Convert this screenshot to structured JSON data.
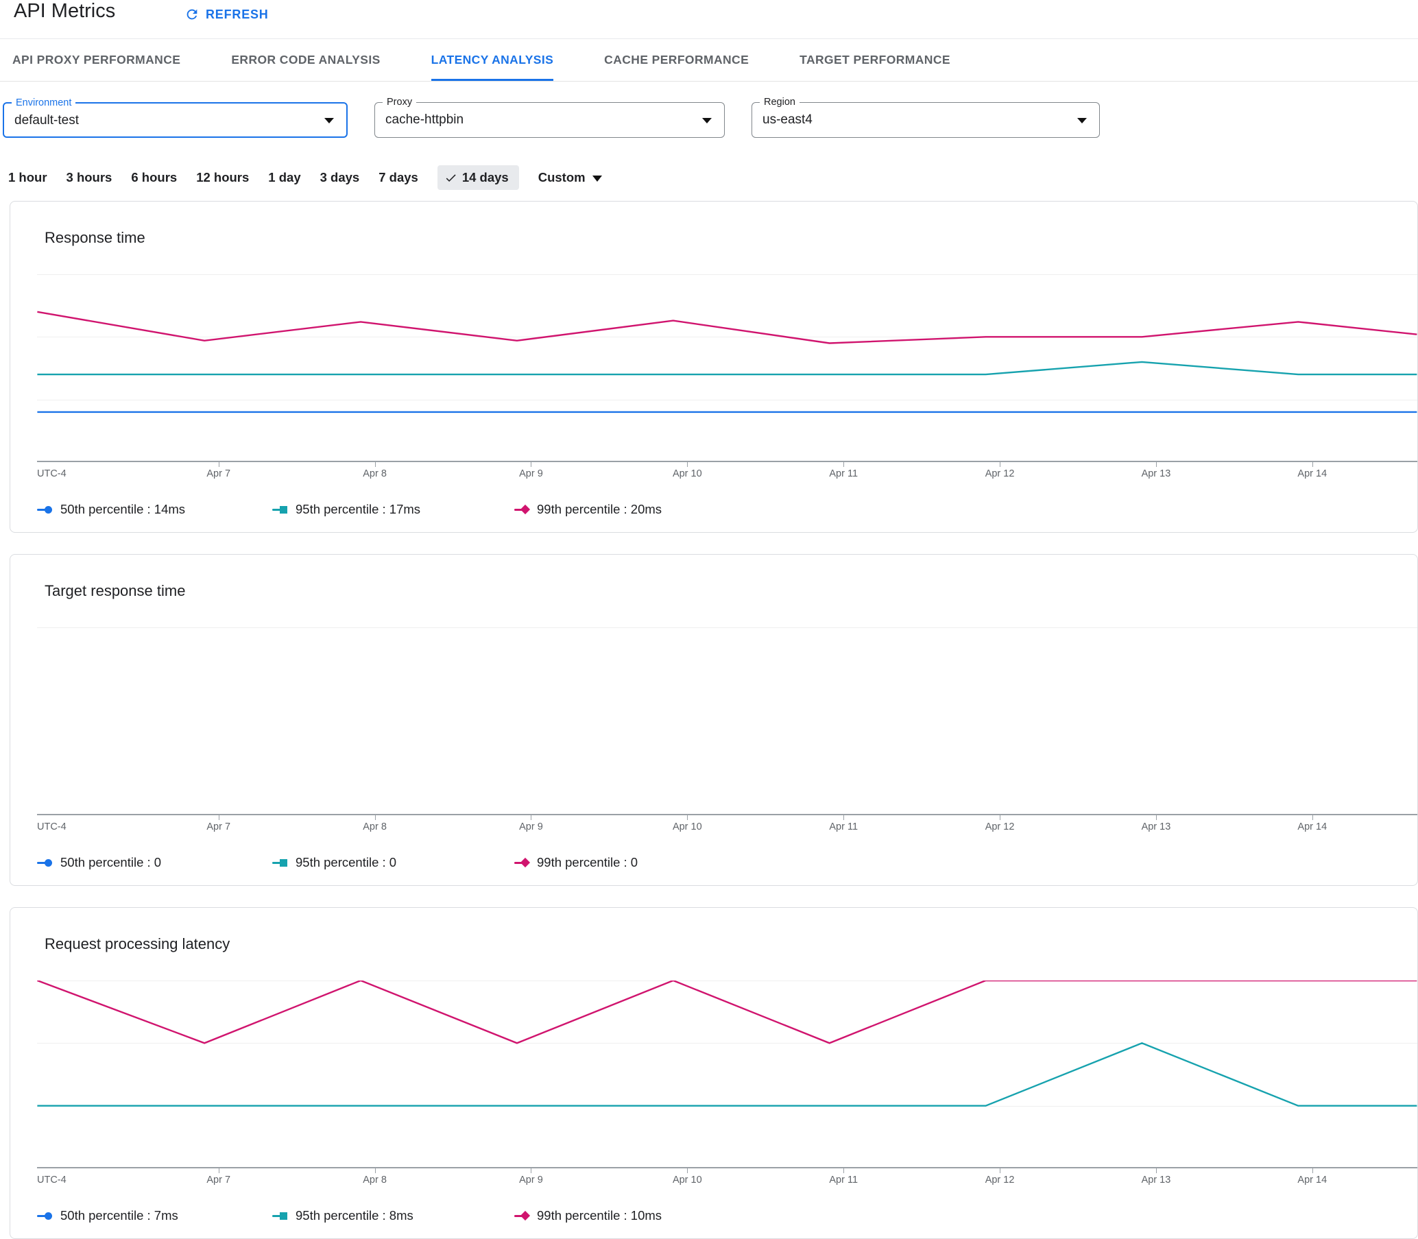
{
  "header": {
    "title": "API Metrics",
    "refresh_label": "REFRESH"
  },
  "tabs": [
    {
      "label": "API PROXY PERFORMANCE",
      "active": false
    },
    {
      "label": "ERROR CODE ANALYSIS",
      "active": false
    },
    {
      "label": "LATENCY ANALYSIS",
      "active": true
    },
    {
      "label": "CACHE PERFORMANCE",
      "active": false
    },
    {
      "label": "TARGET PERFORMANCE",
      "active": false
    }
  ],
  "filters": [
    {
      "label": "Environment",
      "value": "default-test",
      "focused": true
    },
    {
      "label": "Proxy",
      "value": "cache-httpbin",
      "focused": false
    },
    {
      "label": "Region",
      "value": "us-east4",
      "focused": false
    }
  ],
  "time_range": {
    "options": [
      "1 hour",
      "3 hours",
      "6 hours",
      "12 hours",
      "1 day",
      "3 days",
      "7 days",
      "14 days"
    ],
    "selected": "14 days",
    "custom_label": "Custom"
  },
  "colors": {
    "accent_blue": "#1a73e8",
    "series_blue": "#1a73e8",
    "series_teal": "#16a2ae",
    "series_pink": "#d0146e",
    "axis": "#9aa0a6",
    "gridline": "#efefef",
    "chip_bg": "#e8eaed"
  },
  "chart_data": [
    {
      "type": "line",
      "title": "Response time",
      "x_axis_label": "UTC-4",
      "x_ticks": [
        "Apr 7",
        "Apr 8",
        "Apr 9",
        "Apr 10",
        "Apr 11",
        "Apr 12",
        "Apr 13",
        "Apr 14"
      ],
      "x_tick_fracs": [
        0.1315,
        0.2447,
        0.3579,
        0.4711,
        0.5843,
        0.6975,
        0.8107,
        0.9239
      ],
      "x": [
        5.84,
        6.91,
        7.91,
        8.91,
        9.91,
        10.91,
        11.91,
        12.91,
        13.91,
        14.67
      ],
      "ylim": [
        10,
        25
      ],
      "gridline_values": [
        25,
        20,
        15
      ],
      "grid": true,
      "legend_position": "bottom",
      "series": [
        {
          "name": "50th percentile",
          "current_value": "14ms",
          "color_key": "series_blue",
          "marker": "circle",
          "values": [
            14,
            14,
            14,
            14,
            14,
            14,
            14,
            14,
            14,
            14
          ]
        },
        {
          "name": "95th percentile",
          "current_value": "17ms",
          "color_key": "series_teal",
          "marker": "square",
          "values": [
            17,
            17,
            17,
            17,
            17,
            17,
            17,
            18,
            17,
            17
          ]
        },
        {
          "name": "99th percentile",
          "current_value": "20ms",
          "color_key": "series_pink",
          "marker": "diamond",
          "values": [
            22,
            19.7,
            21.2,
            19.7,
            21.3,
            19.5,
            20,
            20,
            21.2,
            20.2
          ]
        }
      ]
    },
    {
      "type": "line",
      "title": "Target response time",
      "x_axis_label": "UTC-4",
      "x_ticks": [
        "Apr 7",
        "Apr 8",
        "Apr 9",
        "Apr 10",
        "Apr 11",
        "Apr 12",
        "Apr 13",
        "Apr 14"
      ],
      "x_tick_fracs": [
        0.1315,
        0.2447,
        0.3579,
        0.4711,
        0.5843,
        0.6975,
        0.8107,
        0.9239
      ],
      "x": [
        5.84,
        6.91,
        7.91,
        8.91,
        9.91,
        10.91,
        11.91,
        12.91,
        13.91,
        14.67
      ],
      "ylim": [
        0,
        1
      ],
      "gridline_values": [
        1
      ],
      "grid": true,
      "legend_position": "bottom",
      "series": [
        {
          "name": "50th percentile",
          "current_value": "0",
          "color_key": "series_blue",
          "marker": "circle",
          "values": [
            0,
            0,
            0,
            0,
            0,
            0,
            0,
            0,
            0,
            0
          ]
        },
        {
          "name": "95th percentile",
          "current_value": "0",
          "color_key": "series_teal",
          "marker": "square",
          "values": [
            0,
            0,
            0,
            0,
            0,
            0,
            0,
            0,
            0,
            0
          ]
        },
        {
          "name": "99th percentile",
          "current_value": "0",
          "color_key": "series_pink",
          "marker": "diamond",
          "values": [
            0,
            0,
            0,
            0,
            0,
            0,
            0,
            0,
            0,
            0
          ]
        }
      ]
    },
    {
      "type": "line",
      "title": "Request processing latency",
      "x_axis_label": "UTC-4",
      "x_ticks": [
        "Apr 7",
        "Apr 8",
        "Apr 9",
        "Apr 10",
        "Apr 11",
        "Apr 12",
        "Apr 13",
        "Apr 14"
      ],
      "x_tick_fracs": [
        0.1315,
        0.2447,
        0.3579,
        0.4711,
        0.5843,
        0.6975,
        0.8107,
        0.9239
      ],
      "x": [
        5.84,
        6.91,
        7.91,
        8.91,
        9.91,
        10.91,
        11.91,
        12.91,
        13.91,
        14.67
      ],
      "ylim": [
        7,
        10
      ],
      "gridline_values": [
        10,
        9,
        8
      ],
      "grid": true,
      "legend_position": "bottom",
      "series": [
        {
          "name": "50th percentile",
          "current_value": "7ms",
          "color_key": "series_blue",
          "marker": "circle",
          "values": [
            7,
            7,
            7,
            7,
            7,
            7,
            7,
            7,
            7,
            7
          ]
        },
        {
          "name": "95th percentile",
          "current_value": "8ms",
          "color_key": "series_teal",
          "marker": "square",
          "values": [
            8,
            8,
            8,
            8,
            8,
            8,
            8,
            9,
            8,
            8
          ]
        },
        {
          "name": "99th percentile",
          "current_value": "10ms",
          "color_key": "series_pink",
          "marker": "diamond",
          "values": [
            10,
            9,
            10,
            9,
            10,
            9,
            10,
            10,
            10,
            10
          ]
        }
      ]
    }
  ]
}
